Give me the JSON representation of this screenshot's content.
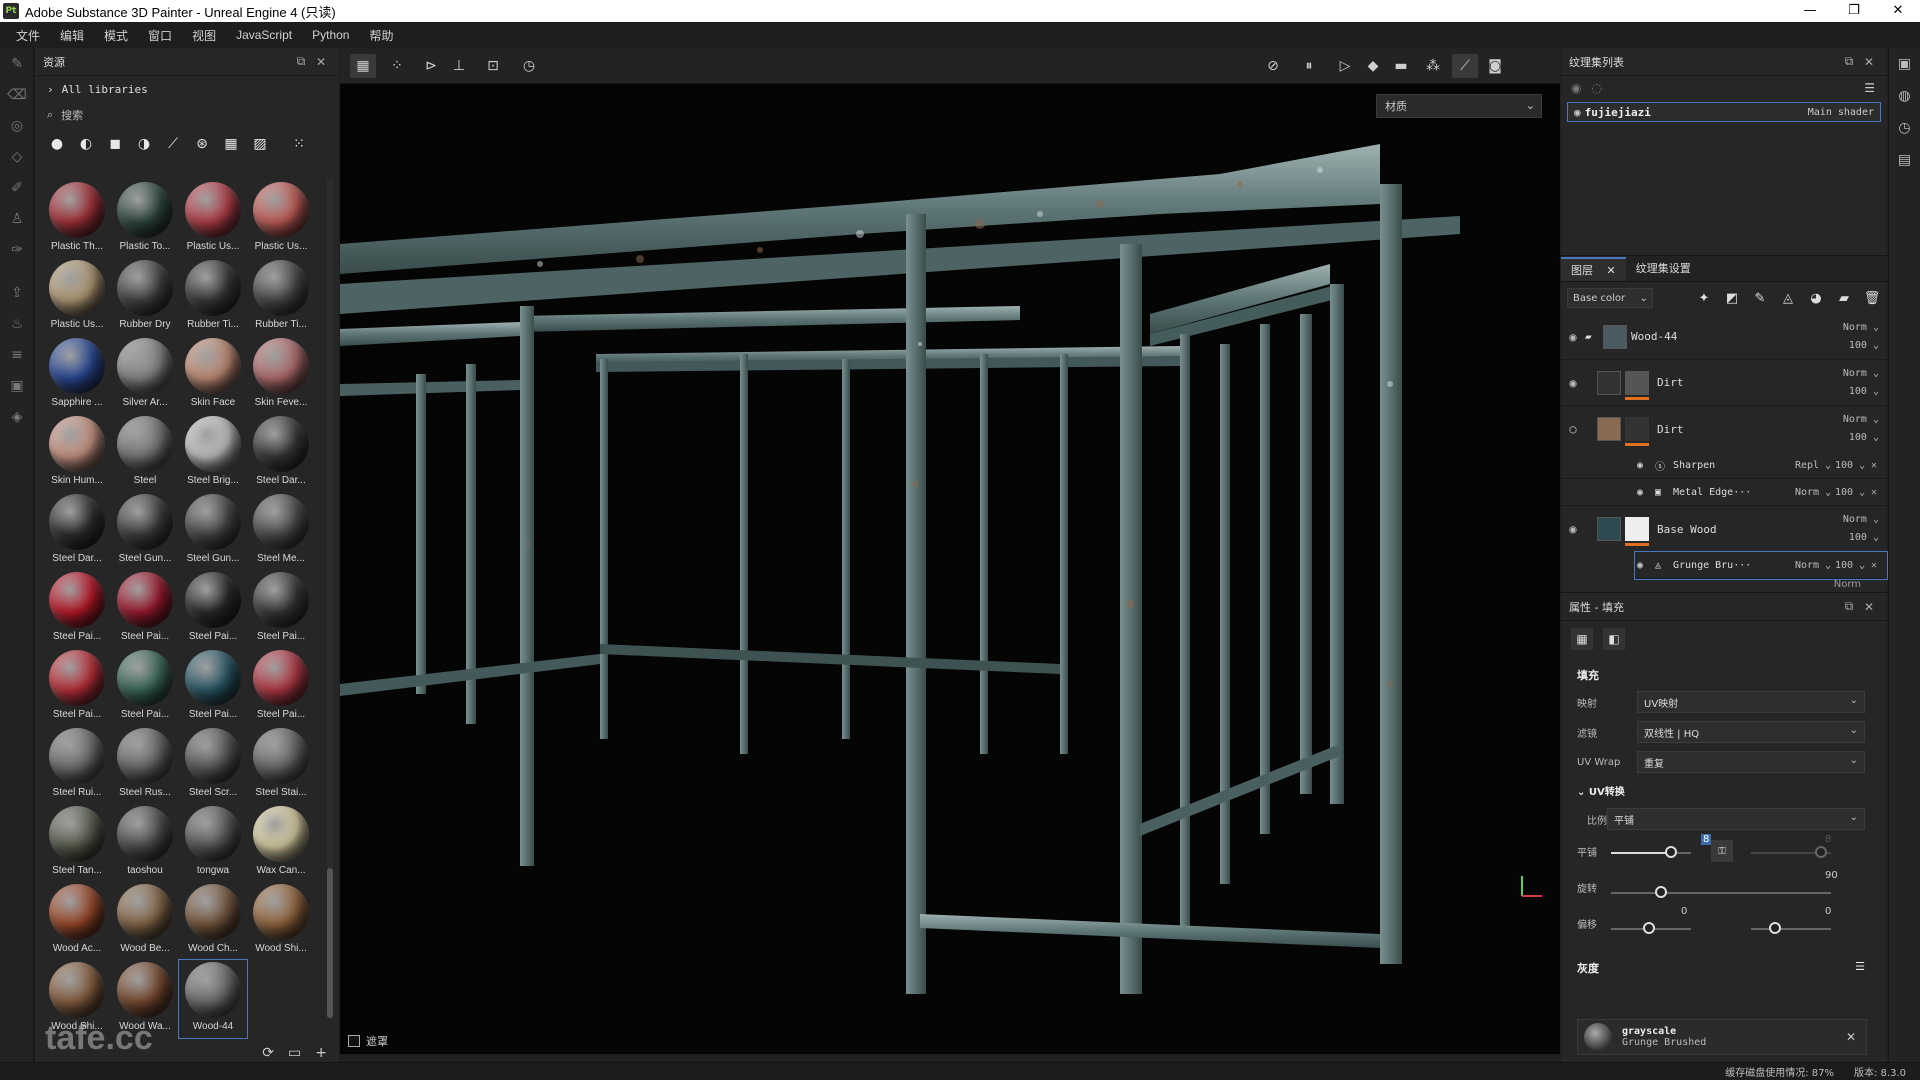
{
  "window": {
    "logo": "Pt",
    "title": "Adobe Substance 3D Painter - Unreal Engine 4 (只读)",
    "controls": [
      "—",
      "❐",
      "✕"
    ]
  },
  "menu": [
    "文件",
    "编辑",
    "模式",
    "窗口",
    "视图",
    "JavaScript",
    "Python",
    "帮助"
  ],
  "assets": {
    "title": "资源",
    "library": "All libraries",
    "search_placeholder": "搜索",
    "materials": [
      {
        "label": "Plastic Th...",
        "color": "#a8323a"
      },
      {
        "label": "Plastic To...",
        "color": "#2f4a40"
      },
      {
        "label": "Plastic Us...",
        "color": "#b8404a"
      },
      {
        "label": "Plastic Us...",
        "color": "#c8605a"
      },
      {
        "label": "Plastic Us...",
        "color": "#b8a07a"
      },
      {
        "label": "Rubber Dry",
        "color": "#444444"
      },
      {
        "label": "Rubber Ti...",
        "color": "#3a3a3a"
      },
      {
        "label": "Rubber Ti...",
        "color": "#4a4a4a"
      },
      {
        "label": "Sapphire ...",
        "color": "#2a4a9a"
      },
      {
        "label": "Silver Ar...",
        "color": "#8a8a8a"
      },
      {
        "label": "Skin Face",
        "color": "#c8907a"
      },
      {
        "label": "Skin Feve...",
        "color": "#b87070"
      },
      {
        "label": "Skin Hum...",
        "color": "#d09a88"
      },
      {
        "label": "Steel",
        "color": "#7a7a7a"
      },
      {
        "label": "Steel Brig...",
        "color": "#c8c8c8"
      },
      {
        "label": "Steel Dar...",
        "color": "#3a3a3a"
      },
      {
        "label": "Steel Dar...",
        "color": "#303030"
      },
      {
        "label": "Steel Gun...",
        "color": "#404040"
      },
      {
        "label": "Steel Gun...",
        "color": "#4a4a4a"
      },
      {
        "label": "Steel Me...",
        "color": "#505050"
      },
      {
        "label": "Steel Pai...",
        "color": "#c0182a"
      },
      {
        "label": "Steel Pai...",
        "color": "#a01a2e"
      },
      {
        "label": "Steel Pai...",
        "color": "#2a2a2a"
      },
      {
        "label": "Steel Pai...",
        "color": "#3a3a3a"
      },
      {
        "label": "Steel Pai...",
        "color": "#c0303a"
      },
      {
        "label": "Steel Pai...",
        "color": "#3a6a5a"
      },
      {
        "label": "Steel Pai...",
        "color": "#2a5a6a"
      },
      {
        "label": "Steel Pai...",
        "color": "#b83a48"
      },
      {
        "label": "Steel Rui...",
        "color": "#707070"
      },
      {
        "label": "Steel Rus...",
        "color": "#6a6a6a"
      },
      {
        "label": "Steel Scr...",
        "color": "#5a5a5a"
      },
      {
        "label": "Steel Stai...",
        "color": "#6a6a6a"
      },
      {
        "label": "Steel Tan...",
        "color": "#5a6050"
      },
      {
        "label": "taoshou",
        "color": "#505050"
      },
      {
        "label": "tongwa",
        "color": "#5a5a5a"
      },
      {
        "label": "Wax Can...",
        "color": "#e0d4a8"
      },
      {
        "label": "Wood Ac...",
        "color": "#a04a2a"
      },
      {
        "label": "Wood Be...",
        "color": "#8a6a4a"
      },
      {
        "label": "Wood Ch...",
        "color": "#7a5a40"
      },
      {
        "label": "Wood Shi...",
        "color": "#9a6a40"
      },
      {
        "label": "Wood Shi...",
        "color": "#8a6040"
      },
      {
        "label": "Wood Wa...",
        "color": "#7a4a30"
      },
      {
        "label": "Wood-44",
        "color": "#707070",
        "selected": true
      }
    ],
    "watermark": "tafe.cc"
  },
  "viewport": {
    "dropdown": "材质",
    "footer_label": "遮罩"
  },
  "texture_set_list": {
    "title": "纹理集列表",
    "item_name": "fujiejiazi",
    "item_shader": "Main shader"
  },
  "layers": {
    "tabs": [
      "图层",
      "纹理集设置"
    ],
    "channel": "Base color",
    "items": [
      {
        "name": "Wood-44",
        "blend": "Norm",
        "opacity": "100",
        "visible": true
      },
      {
        "name": "Dirt",
        "blend": "Norm",
        "opacity": "100",
        "visible": true
      },
      {
        "name": "Dirt",
        "blend": "Norm",
        "opacity": "100",
        "visible": false
      }
    ],
    "effects_a": [
      {
        "name": "Sharpen",
        "blend": "Repl",
        "opacity": "100"
      },
      {
        "name": "Metal Edge···",
        "blend": "Norm",
        "opacity": "100"
      }
    ],
    "base_wood": {
      "name": "Base Wood",
      "blend": "Norm",
      "opacity": "100"
    },
    "effects_b": [
      {
        "name": "Grunge Bru···",
        "blend": "Norm",
        "opacity": "100"
      }
    ],
    "trailing_blend": "Norm"
  },
  "properties": {
    "title": "属性 - 填充",
    "section_fill": "填充",
    "mapping_label": "映射",
    "mapping_value": "UV映射",
    "filter_label": "滤镜",
    "filter_value": "双线性 | HQ",
    "uvwrap_label": "UV Wrap",
    "uvwrap_value": "重复",
    "uv_transform": "UV转换",
    "ratio_label": "比例",
    "ratio_value": "平铺",
    "tile_label": "平铺",
    "tile_value": "8",
    "tile_value_b": "8",
    "rotate_label": "旋转",
    "rotate_value": "90",
    "offset_label": "偏移",
    "offset_value_a": "0",
    "offset_value_b": "0",
    "grayscale_section": "灰度",
    "grayscale_name": "grayscale",
    "grayscale_sub": "Grunge Brushed"
  },
  "status": {
    "cache": "缓存磁盘使用情况:  87%",
    "version": "版本:  8.3.0"
  }
}
